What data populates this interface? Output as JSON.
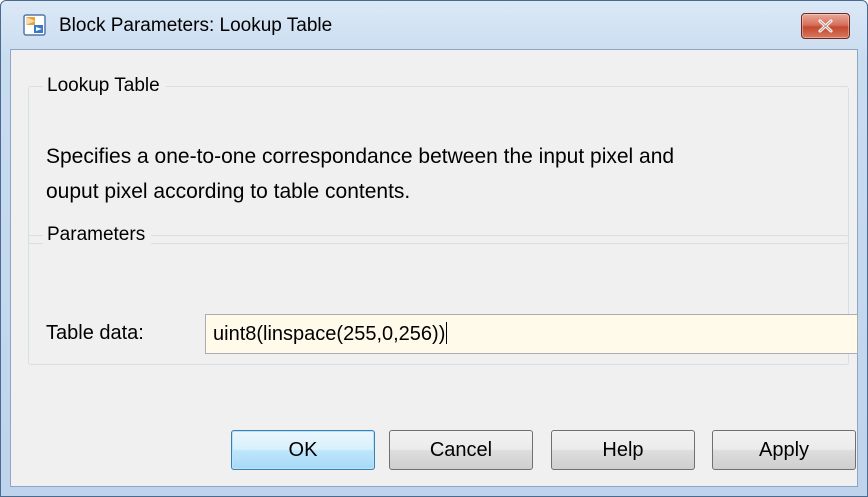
{
  "window": {
    "title": "Block Parameters: Lookup Table",
    "app_icon": "simulink-block-icon",
    "close_icon": "close-icon"
  },
  "description_group": {
    "legend": "Lookup Table",
    "lines": [
      "Specifies a one-to-one correspondance between the input pixel and",
      "ouput pixel according to table contents."
    ]
  },
  "parameters_group": {
    "legend": "Parameters",
    "table_data": {
      "label": "Table data:",
      "value": "uint8(linspace(255,0,256))"
    }
  },
  "buttons": {
    "ok": "OK",
    "cancel": "Cancel",
    "help": "Help",
    "apply": "Apply"
  },
  "colors": {
    "input_background": "#fffaea",
    "close_button": "#c44a30",
    "default_button_border": "#3c7fb1"
  }
}
